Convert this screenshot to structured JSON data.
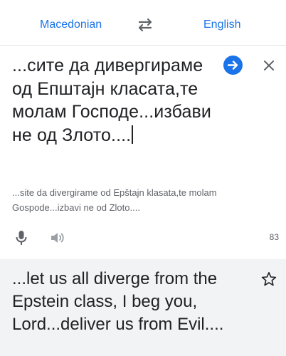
{
  "languages": {
    "source": "Macedonian",
    "target": "English"
  },
  "source": {
    "text": "...сите да дивергираме од Епштајн класата,те молам Господе...избави не од Злото....",
    "transliteration": "...site da divergirame od Epštajn klasata,te molam Gospode...izbavi ne od Zloto....",
    "char_count": "83"
  },
  "translation": {
    "text": "...let us all diverge from the Epstein class, I beg you, Lord...deliver us from Evil...."
  },
  "icons": {
    "swap": "swap-arrows-icon",
    "go": "arrow-right-circle-icon",
    "close": "close-icon",
    "mic": "microphone-icon",
    "speaker": "speaker-icon",
    "star": "star-outline-icon"
  },
  "colors": {
    "accent": "#1a73e8",
    "text": "#202124",
    "muted": "#5f6368",
    "translation_bg": "#f1f3f4"
  }
}
